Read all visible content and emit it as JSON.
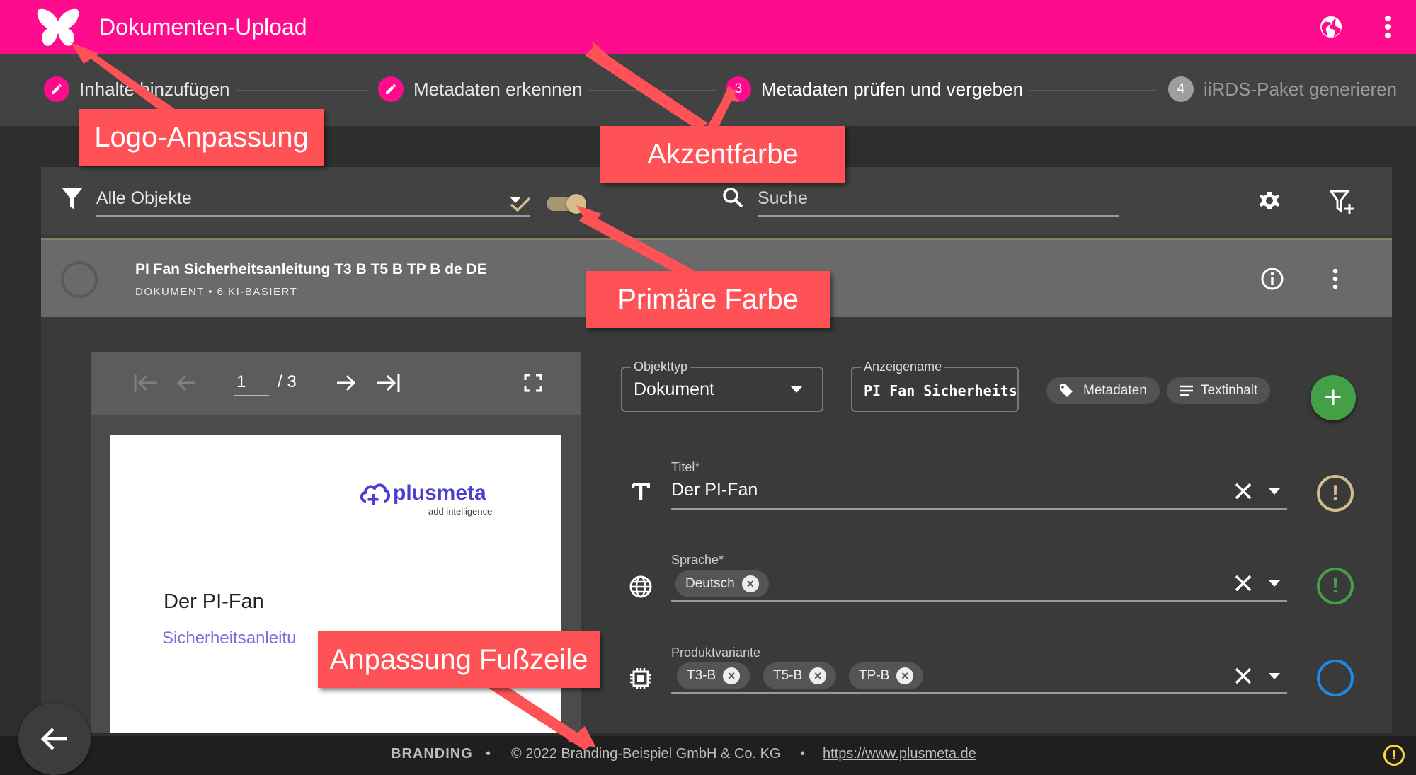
{
  "colors": {
    "primary": "#d3bd8a",
    "accent": "#ff0b8d",
    "success": "#43a047",
    "info": "#1e88e5",
    "warning": "#fdd835",
    "callout": "#ff5257"
  },
  "header": {
    "title": "Dokumenten-Upload",
    "logo_icon": "butterfly-icon",
    "language_icon": "globe-icon",
    "menu_icon": "more-vert-icon"
  },
  "stepper": {
    "steps": [
      {
        "label": "Inhalte hinzufügen",
        "icon": "edit-icon",
        "state": "done"
      },
      {
        "label": "Metadaten erkennen",
        "icon": "edit-icon",
        "state": "done"
      },
      {
        "number": "3",
        "label": "Metadaten prüfen und vergeben",
        "state": "active"
      },
      {
        "number": "4",
        "label": "iiRDS-Paket generieren",
        "state": "pending"
      }
    ]
  },
  "toolbar": {
    "filter_value": "Alle Objekte",
    "toggle_on": true,
    "search_placeholder": "Suche",
    "settings_icon": "gear-icon",
    "filter_add_icon": "filter-add-icon"
  },
  "item": {
    "title": "PI Fan Sicherheitsanleitung T3 B T5 B TP B de DE",
    "subtitle": "DOKUMENT • 6 KI-BASIERT"
  },
  "viewer": {
    "page_current": "1",
    "page_total": "/ 3",
    "doc_logo": "plusmeta",
    "doc_logo_tagline": "add intelligence",
    "doc_title": "Der PI-Fan",
    "doc_subtitle": "Sicherheitsanleitu"
  },
  "form": {
    "object_type": {
      "label": "Objekttyp",
      "value": "Dokument"
    },
    "display_name": {
      "label": "Anzeigename",
      "value": "PI Fan Sicherheits"
    },
    "buttons": {
      "metadata": "Metadaten",
      "text_content": "Textinhalt",
      "add": "+"
    },
    "fields": [
      {
        "label": "Titel*",
        "value": "Der PI-Fan",
        "icon": "text-t-icon",
        "status": "warning"
      },
      {
        "label": "Sprache*",
        "chips": [
          "Deutsch"
        ],
        "icon": "globe-icon",
        "status": "success"
      },
      {
        "label": "Produktvariante",
        "chips": [
          "T3-B",
          "T5-B",
          "TP-B"
        ],
        "icon": "chip-icon",
        "status": "info"
      }
    ],
    "status_glyph": "!"
  },
  "footer": {
    "branding": "BRANDING",
    "separator": "•",
    "copyright": "© 2022 Branding-Beispiel GmbH & Co. KG",
    "link": "https://www.plusmeta.de"
  },
  "callouts": {
    "logo": "Logo-Anpassung",
    "accent": "Akzentfarbe",
    "primary": "Primäre Farbe",
    "footer": "Anpassung Fußzeile"
  }
}
